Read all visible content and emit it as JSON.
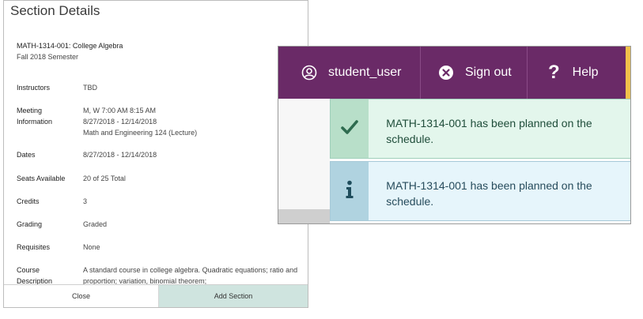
{
  "panel": {
    "title": "Section Details",
    "course_title": "MATH-1314-001: College Algebra",
    "term": "Fall 2018 Semester",
    "rows": [
      {
        "label": "Instructors",
        "value": "TBD"
      },
      {
        "label": "Meeting Information",
        "value": "M, W 7:00 AM 8:15 AM\n8/27/2018 - 12/14/2018\nMath and Engineering 124 (Lecture)"
      },
      {
        "label": "Dates",
        "value": "8/27/2018 - 12/14/2018"
      },
      {
        "label": "Seats Available",
        "value": "20 of 25 Total"
      },
      {
        "label": "Credits",
        "value": "3"
      },
      {
        "label": "Grading",
        "value": "Graded"
      },
      {
        "label": "Requisites",
        "value": "None"
      },
      {
        "label": "Course Description",
        "value": "A standard course in college algebra. Quadratic equations; ratio and proportion; variation, binomial theorem;"
      }
    ],
    "close_label": "Close",
    "add_label": "Add Section"
  },
  "nav": {
    "user_label": "student_user",
    "signout_label": "Sign out",
    "help_label": "Help"
  },
  "notices": {
    "success_text": "MATH-1314-001 has been planned on the schedule.",
    "info_text": "MATH-1314-001 has been planned on the schedule."
  },
  "colors": {
    "nav_purple": "#6a2a67",
    "nav_accent": "#f0c14b",
    "success_icon": "#2e6b4f",
    "info_icon": "#1f4d5c",
    "add_button": "#cfe4df"
  },
  "icons": {
    "user": "user-circle-icon",
    "signout": "close-circle-icon",
    "help": "question-icon",
    "success": "checkmark-icon",
    "info": "info-icon"
  }
}
